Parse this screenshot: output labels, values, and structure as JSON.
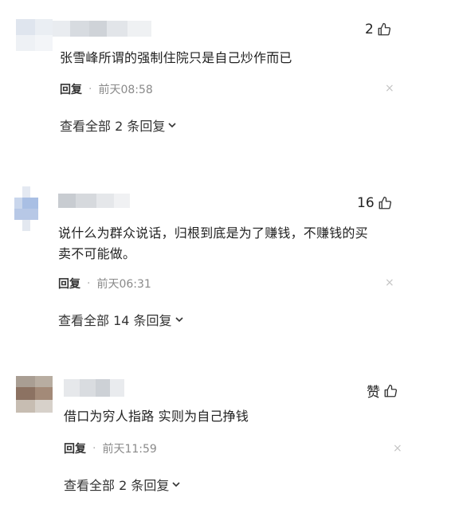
{
  "comments": [
    {
      "likes": "2",
      "text_lines": [
        "张雪峰所谓的强制住院只是自己炒作而已"
      ],
      "reply_label": "回复",
      "separator": "·",
      "time": "前天08:58",
      "close": "×",
      "view_all": "查看全部 2 条回复"
    },
    {
      "likes": "16",
      "text_lines": [
        "说什么为群众说话，归根到底是为了赚钱，不赚钱的买",
        "卖不可能做。"
      ],
      "reply_label": "回复",
      "separator": "·",
      "time": "前天06:31",
      "close": "×",
      "view_all": "查看全部 14 条回复"
    },
    {
      "likes": "赞",
      "text_lines": [
        "借口为穷人指路 实则为自己挣钱"
      ],
      "reply_label": "回复",
      "separator": "·",
      "time": "前天11:59",
      "close": "×",
      "view_all": "查看全部 2 条回复"
    }
  ],
  "icons": {
    "like": "thumbs-up-icon",
    "expand": "chevron-down-icon",
    "close": "close-icon"
  },
  "colors": {
    "text": "#222222",
    "meta": "#8a8a8a",
    "close": "#c4c4c4"
  }
}
